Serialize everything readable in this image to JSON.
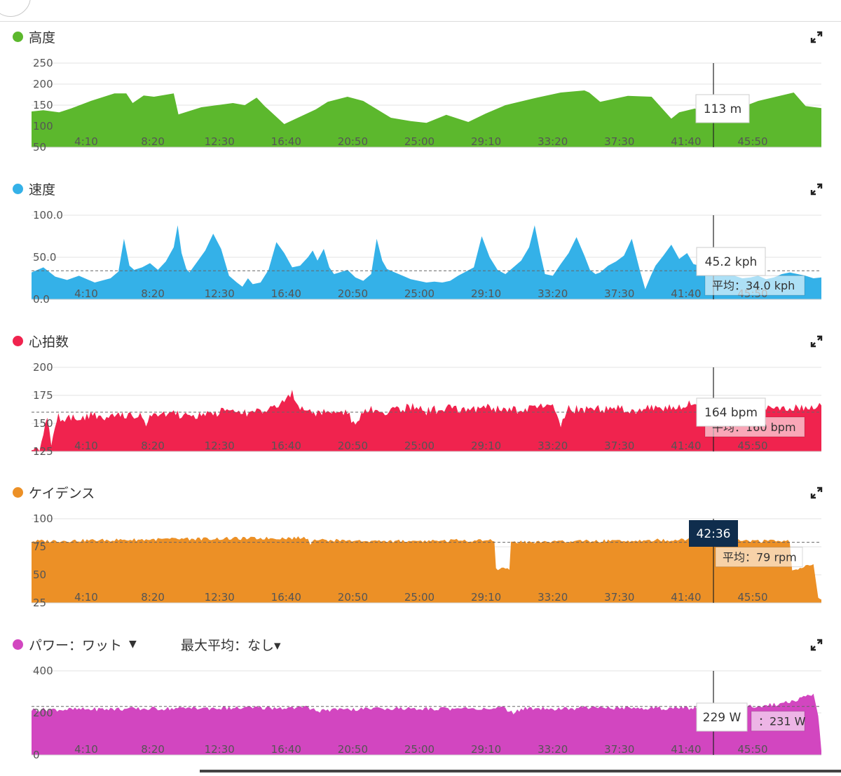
{
  "crosshair_time": "42:36",
  "x_ticks": [
    "4:10",
    "8:20",
    "12:30",
    "16:40",
    "20:50",
    "25:00",
    "29:10",
    "33:20",
    "37:30",
    "41:40",
    "45:50"
  ],
  "panels": [
    {
      "id": "altitude",
      "label": "高度",
      "color": "#5cb82d",
      "expand_icon": "expand-icon"
    },
    {
      "id": "speed",
      "label": "速度",
      "color": "#34b1e8",
      "expand_icon": "expand-icon"
    },
    {
      "id": "heartrate",
      "label": "心拍数",
      "color": "#f0234e",
      "expand_icon": "expand-icon"
    },
    {
      "id": "cadence",
      "label": "ケイデンス",
      "color": "#ec9026",
      "expand_icon": "expand-icon"
    },
    {
      "id": "power",
      "label": "パワー：ワット",
      "dropdown_icon": "triangle-down",
      "sub_label": "最大平均：なし▾",
      "color": "#d246c0",
      "expand_icon": "expand-icon"
    }
  ],
  "chart_data": [
    {
      "type": "area",
      "title": "高度",
      "unit": "m",
      "ylim": [
        50,
        250
      ],
      "y_ticks": [
        "250",
        "200",
        "150",
        "100",
        "50"
      ],
      "x": [
        0,
        1.5,
        3.5,
        5,
        7.5,
        10.5,
        12,
        12.8,
        14.2,
        15.5,
        18,
        18.6,
        21.5,
        25.5,
        27,
        28.5,
        29.5,
        32,
        36,
        37.5,
        40,
        42,
        45.5,
        48,
        50,
        52.5,
        54,
        55.3,
        57.5,
        60,
        64,
        67,
        70,
        70.6,
        72,
        75.5,
        78.5,
        81,
        82,
        84,
        85.6,
        88.5,
        92,
        96.5,
        98,
        100
      ],
      "values": [
        135,
        138,
        133,
        142,
        160,
        178,
        178,
        155,
        173,
        170,
        178,
        128,
        145,
        155,
        150,
        168,
        148,
        105,
        140,
        158,
        170,
        160,
        120,
        112,
        108,
        127,
        118,
        110,
        130,
        150,
        168,
        180,
        185,
        180,
        158,
        172,
        170,
        118,
        133,
        142,
        117,
        135,
        160,
        180,
        148,
        143
      ],
      "tooltip": "113 m"
    },
    {
      "type": "area",
      "title": "速度",
      "unit": "kph",
      "ylim": [
        0,
        100
      ],
      "y_ticks": [
        "100.0",
        "50.0",
        "0.0"
      ],
      "average": 34.0,
      "average_label": "平均：34.0 kph",
      "x": [
        0,
        1.5,
        3,
        4.5,
        6,
        8,
        10,
        11,
        11.7,
        12.4,
        13,
        14,
        15,
        16,
        17,
        18,
        18.5,
        19,
        19.6,
        20,
        21,
        22,
        23,
        24,
        25,
        26,
        26.7,
        27.4,
        28,
        29,
        30,
        31,
        32,
        33,
        34,
        35,
        35.6,
        36.2,
        37,
        37.7,
        38.3,
        39,
        40,
        41,
        42,
        43,
        43.7,
        44.4,
        45,
        46,
        47,
        48,
        49,
        50,
        51,
        52,
        53,
        54,
        55,
        56,
        57,
        58,
        59,
        60,
        61,
        62,
        63,
        63.7,
        64.4,
        65,
        66,
        67,
        68,
        69,
        70,
        70.7,
        71.4,
        72,
        73,
        74,
        75,
        76,
        77,
        77.7,
        78.4,
        79,
        80,
        81,
        82,
        83,
        83.8,
        84.5,
        85,
        86,
        87,
        88,
        89,
        90,
        91,
        92,
        93,
        94,
        95,
        96,
        97,
        98,
        99,
        100
      ],
      "values": [
        32,
        38,
        27,
        23,
        28,
        20,
        25,
        33,
        72,
        40,
        35,
        38,
        43,
        35,
        45,
        62,
        88,
        55,
        36,
        32,
        45,
        58,
        78,
        60,
        28,
        20,
        15,
        25,
        18,
        20,
        35,
        68,
        55,
        38,
        40,
        50,
        58,
        46,
        60,
        38,
        30,
        32,
        35,
        26,
        22,
        30,
        72,
        46,
        36,
        32,
        28,
        24,
        22,
        20,
        21,
        20,
        22,
        28,
        33,
        38,
        75,
        50,
        35,
        30,
        38,
        46,
        62,
        88,
        55,
        30,
        28,
        42,
        55,
        74,
        52,
        35,
        30,
        32,
        40,
        45,
        52,
        72,
        35,
        12,
        28,
        40,
        52,
        65,
        48,
        55,
        42,
        40,
        35,
        30,
        28,
        30,
        28,
        25,
        26,
        28,
        24,
        26,
        30,
        32,
        30,
        28,
        25,
        26
      ],
      "tooltip": "45.2 kph"
    },
    {
      "type": "area",
      "title": "心拍数",
      "unit": "bpm",
      "ylim": [
        125,
        200
      ],
      "y_ticks": [
        "200",
        "175",
        "150",
        "125"
      ],
      "average": 160,
      "average_label": "平均：160 bpm",
      "x": [
        0,
        1,
        2,
        2.5,
        3.4,
        4.2,
        5,
        6,
        8,
        10,
        12,
        13.5,
        14.5,
        15.2,
        16,
        18,
        20,
        22,
        24,
        26,
        28,
        30,
        32,
        33,
        33.5,
        34,
        36,
        38,
        40,
        41,
        42,
        43,
        45,
        47,
        48,
        50,
        52,
        53,
        54,
        56,
        58,
        60,
        62,
        64,
        66,
        67,
        68,
        70,
        72,
        74,
        76,
        78,
        80,
        82,
        84,
        85,
        86,
        88,
        90,
        92,
        94,
        96,
        98,
        100
      ],
      "values": [
        130,
        129,
        153,
        128,
        156,
        153,
        155,
        156,
        157,
        155,
        157,
        158,
        150,
        157,
        157,
        158,
        157,
        159,
        160,
        159,
        160,
        164,
        168,
        176,
        165,
        162,
        160,
        162,
        161,
        146,
        161,
        162,
        160,
        163,
        165,
        161,
        163,
        164,
        162,
        163,
        164,
        161,
        163,
        164,
        165,
        148,
        163,
        162,
        163,
        164,
        162,
        163,
        164,
        166,
        167,
        170,
        164,
        165,
        163,
        165,
        162,
        163,
        164,
        166
      ],
      "tooltip": "164 bpm"
    },
    {
      "type": "area",
      "title": "ケイデンス",
      "unit": "rpm",
      "ylim": [
        25,
        100
      ],
      "y_ticks": [
        "100",
        "75",
        "50",
        "25"
      ],
      "average": 79,
      "average_label": "平均：79 rpm",
      "x": [
        0,
        10,
        20,
        35,
        35.3,
        35.6,
        45,
        58.6,
        58.8,
        60.5,
        60.7,
        70,
        80,
        85,
        92,
        96,
        96.3,
        99,
        99.3,
        99.6,
        100
      ],
      "values": [
        80,
        81,
        82,
        83,
        78,
        81,
        80,
        81,
        55,
        55,
        79,
        80,
        81,
        82,
        80,
        80,
        53,
        60,
        45,
        30,
        28
      ],
      "tooltip": "42:36"
    },
    {
      "type": "area",
      "title": "パワー：ワット",
      "unit": "W",
      "ylim": [
        0,
        400
      ],
      "y_ticks": [
        "400",
        "200",
        "0"
      ],
      "average": 231,
      "average_label": "：231 W",
      "x": [
        0,
        10,
        20,
        35,
        36,
        45,
        50,
        60,
        61,
        62,
        70,
        80,
        85,
        88,
        90,
        92,
        94,
        96,
        97,
        98,
        99,
        99.6,
        100
      ],
      "values": [
        215,
        218,
        222,
        225,
        210,
        222,
        220,
        222,
        195,
        220,
        222,
        223,
        224,
        226,
        230,
        235,
        240,
        250,
        265,
        275,
        290,
        180,
        20
      ],
      "tooltip": "229 W"
    }
  ]
}
